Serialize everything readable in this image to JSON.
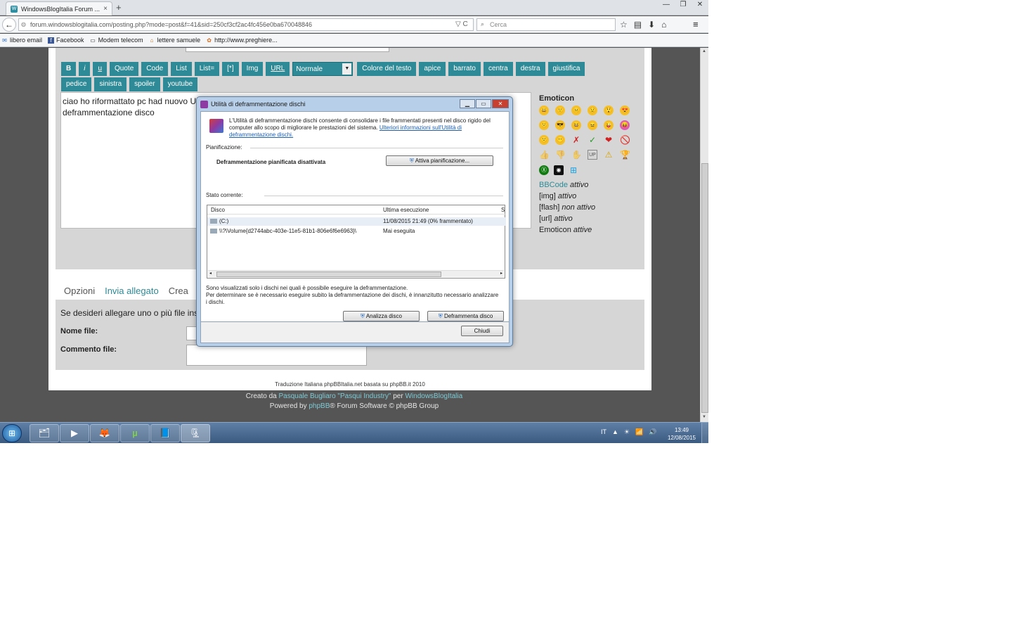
{
  "browser": {
    "tab_title": "WindowsBlogItalia Forum ...",
    "tab_close": "×",
    "new_tab": "+",
    "window_controls": [
      "—",
      "❐",
      "✕"
    ],
    "url": "forum.windowsblogitalia.com/posting.php?mode=post&f=41&sid=250cf3cf2ac4fc456e0ba670048846",
    "url_controls": "▽ C",
    "search_placeholder": "Cerca",
    "nav_icons": [
      "☆",
      "▤",
      "⬇",
      "⌂"
    ],
    "menu_icon": "≡",
    "bookmarks": [
      {
        "icon": "✉",
        "label": "libero email"
      },
      {
        "icon": "f",
        "label": "Facebook"
      },
      {
        "icon": "▭",
        "label": "Modem telecom"
      },
      {
        "icon": "⌂",
        "label": "lettere samuele"
      },
      {
        "icon": "✿",
        "label": "http://www.preghiere..."
      }
    ]
  },
  "editor": {
    "buttons_row1": [
      "B",
      "i",
      "u",
      "Quote",
      "Code",
      "List",
      "List=",
      "[*]",
      "Img",
      "URL"
    ],
    "font_size_select": "Normale",
    "buttons_row1b": [
      "Colore del testo",
      "apice",
      "barrato",
      "centra",
      "destra",
      "giustifica"
    ],
    "buttons_row2": [
      "pedice",
      "sinistra",
      "spoiler",
      "youtube"
    ],
    "message_text": "ciao ho riformattato pc had nuovo U",
    "message_text_line2": "deframmentazione disco"
  },
  "emoticons": {
    "title": "Emoticon",
    "smileys": [
      "😀",
      "🙂",
      "😐",
      "😟",
      "😲",
      "😍",
      "😕",
      "😎",
      "😆",
      "😖",
      "😜",
      "😝",
      "🙁",
      "😶",
      "✗",
      "✓",
      "❤",
      "🚫",
      "👍",
      "👎",
      "✋",
      "UP",
      "⚠",
      "🏆"
    ],
    "extra_icons": [
      "Ⓧ",
      "◉",
      "⊞"
    ],
    "status": [
      {
        "prefix": "BBCode",
        "state": "attivo"
      },
      {
        "prefix": "[img]",
        "state": "attivo"
      },
      {
        "prefix": "[flash]",
        "state": "non attivo"
      },
      {
        "prefix": "[url]",
        "state": "attivo"
      },
      {
        "prefix": "Emoticon",
        "state": "attive"
      }
    ]
  },
  "tabs": [
    "Opzioni",
    "Invia allegato",
    "Crea"
  ],
  "attachments": {
    "intro": "Se desideri allegare uno o più file inseri",
    "filename_label": "Nome file:",
    "comment_label": "Commento file:"
  },
  "footer": {
    "translation": "Traduzione Italiana phpBBItalia.net basata su phpBB.it 2010",
    "created_by_prefix": "Creato da",
    "created_by_link": "Pasquale Bugliaro \"Pasqui Industry\"",
    "created_by_mid": "per",
    "created_by_link2": "WindowsBlogItalia",
    "powered_prefix": "Powered by",
    "powered_link": "phpBB",
    "powered_suffix": "® Forum Software © phpBB Group"
  },
  "dialog": {
    "title": "Utilità di deframmentazione dischi",
    "description": "L'Utilità di deframmentazione dischi consente di consolidare i file frammentati presenti nel disco rigido del computer allo scopo di migliorare le prestazioni del sistema.",
    "more_info_link": "Ulteriori informazioni sull'Utilità di deframmentazione dischi.",
    "schedule_label": "Pianificazione:",
    "schedule_status": "Deframmentazione pianificata disattivata",
    "schedule_button": "Attiva pianificazione...",
    "current_state_label": "Stato corrente:",
    "col_disk": "Disco",
    "col_last_run": "Ultima esecuzione",
    "col_status": "S",
    "disks": [
      {
        "name": "(C:)",
        "last_run": "11/08/2015 21:49 (0% frammentato)"
      },
      {
        "name": "\\\\?\\Volume{d2744abc-403e-11e5-81b1-806e6f6e6963}\\",
        "last_run": "Mai eseguita"
      }
    ],
    "note_line1": "Sono visualizzati solo i dischi nei quali è possibile eseguire la deframmentazione.",
    "note_line2": "Per determinare se è necessario eseguire subito la deframmentazione dei dischi, è innanzitutto necessario analizzare i dischi.",
    "analyze_button": "Analizza disco",
    "defrag_button": "Deframmenta disco",
    "close_button": "Chiudi"
  },
  "taskbar": {
    "start_icon": "⊞",
    "apps": [
      "🗂",
      "▶",
      "🦊",
      "µ",
      "📘",
      "🗜"
    ],
    "tray": [
      "IT",
      "▲",
      "☀",
      "📶",
      "🔊"
    ],
    "time": "13:49",
    "date": "12/08/2015"
  }
}
